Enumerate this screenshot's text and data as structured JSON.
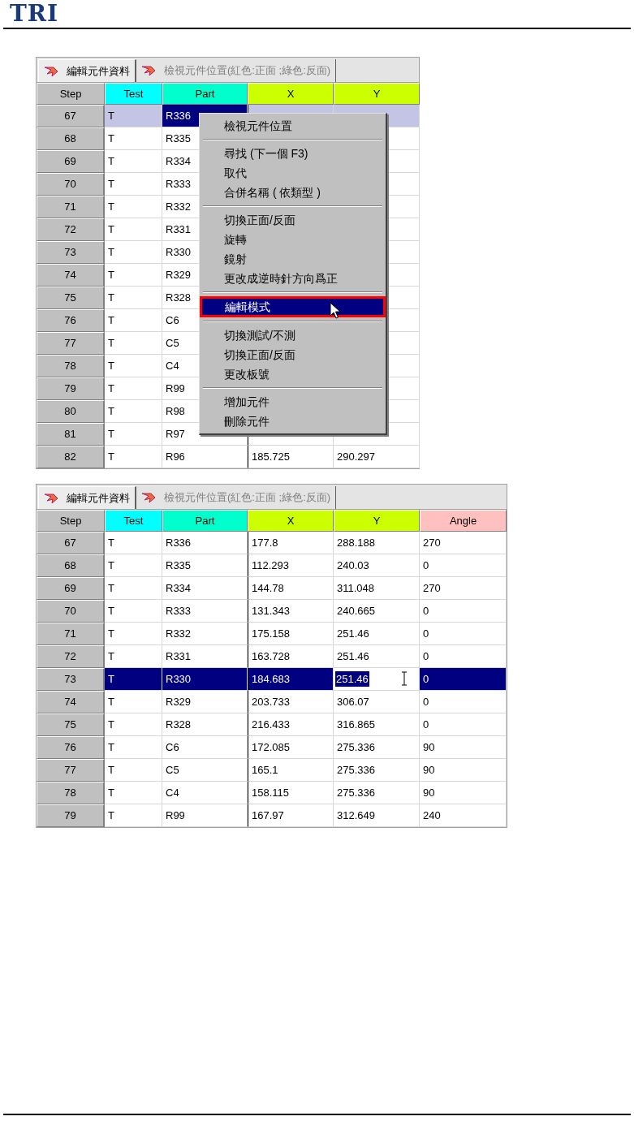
{
  "logo": "TRI",
  "grids": [
    {
      "tabs": [
        {
          "label": "編輯元件資料",
          "selected": true
        },
        {
          "label": "檢視元件位置(紅色:正面 ;綠色:反面)",
          "selected": false
        }
      ],
      "columns": [
        {
          "label": "Step",
          "color": "#c0c0c0"
        },
        {
          "label": "Test",
          "color": "#00ffff"
        },
        {
          "label": "Part",
          "color": "#00ffcc"
        },
        {
          "label": "X",
          "color": "#ccff00"
        },
        {
          "label": "Y",
          "color": "#ccff00"
        }
      ],
      "rows": [
        {
          "step": "67",
          "selected": true,
          "cells": [
            {
              "text": "T",
              "kind": "normal"
            },
            {
              "text": "R336",
              "kind": "focused"
            }
          ]
        },
        {
          "step": "68",
          "selected": false,
          "cells": [
            {
              "text": "T",
              "kind": "normal"
            },
            {
              "text": "R335",
              "kind": "normal"
            }
          ]
        },
        {
          "step": "69",
          "selected": false,
          "cells": [
            {
              "text": "T",
              "kind": "normal"
            },
            {
              "text": "R334",
              "kind": "normal"
            }
          ]
        },
        {
          "step": "70",
          "selected": false,
          "cells": [
            {
              "text": "T",
              "kind": "normal"
            },
            {
              "text": "R333",
              "kind": "normal"
            }
          ]
        },
        {
          "step": "71",
          "selected": false,
          "cells": [
            {
              "text": "T",
              "kind": "normal"
            },
            {
              "text": "R332",
              "kind": "normal"
            }
          ]
        },
        {
          "step": "72",
          "selected": false,
          "cells": [
            {
              "text": "T",
              "kind": "normal"
            },
            {
              "text": "R331",
              "kind": "normal"
            }
          ]
        },
        {
          "step": "73",
          "selected": false,
          "cells": [
            {
              "text": "T",
              "kind": "normal"
            },
            {
              "text": "R330",
              "kind": "normal"
            }
          ]
        },
        {
          "step": "74",
          "selected": false,
          "cells": [
            {
              "text": "T",
              "kind": "normal"
            },
            {
              "text": "R329",
              "kind": "normal"
            }
          ]
        },
        {
          "step": "75",
          "selected": false,
          "cells": [
            {
              "text": "T",
              "kind": "normal"
            },
            {
              "text": "R328",
              "kind": "normal"
            }
          ]
        },
        {
          "step": "76",
          "selected": false,
          "cells": [
            {
              "text": "T",
              "kind": "normal"
            },
            {
              "text": "C6",
              "kind": "normal"
            }
          ]
        },
        {
          "step": "77",
          "selected": false,
          "cells": [
            {
              "text": "T",
              "kind": "normal"
            },
            {
              "text": "C5",
              "kind": "normal"
            }
          ]
        },
        {
          "step": "78",
          "selected": false,
          "cells": [
            {
              "text": "T",
              "kind": "normal"
            },
            {
              "text": "C4",
              "kind": "normal"
            }
          ]
        },
        {
          "step": "79",
          "selected": false,
          "cells": [
            {
              "text": "T",
              "kind": "normal"
            },
            {
              "text": "R99",
              "kind": "normal"
            }
          ]
        },
        {
          "step": "80",
          "selected": false,
          "cells": [
            {
              "text": "T",
              "kind": "normal"
            },
            {
              "text": "R98",
              "kind": "normal"
            }
          ]
        },
        {
          "step": "81",
          "selected": false,
          "cells": [
            {
              "text": "T",
              "kind": "normal"
            },
            {
              "text": "R97",
              "kind": "normal"
            }
          ]
        },
        {
          "step": "82",
          "selected": false,
          "cells": [
            {
              "text": "T",
              "kind": "normal"
            },
            {
              "text": "R96",
              "kind": "normal"
            },
            {
              "text": "185.725",
              "kind": "normal"
            },
            {
              "text": "290.297",
              "kind": "normal"
            }
          ]
        }
      ],
      "context_menu": {
        "groups": [
          [
            {
              "label": "檢視元件位置",
              "highlighted": false
            }
          ],
          [
            {
              "label": "尋找 (下一個 F3)",
              "highlighted": false
            },
            {
              "label": "取代",
              "highlighted": false
            },
            {
              "label": "合併名稱 ( 依類型 )",
              "highlighted": false
            }
          ],
          [
            {
              "label": "切換正面/反面",
              "highlighted": false
            },
            {
              "label": "旋轉",
              "highlighted": false
            },
            {
              "label": "鏡射",
              "highlighted": false
            },
            {
              "label": "更改成逆時針方向爲正",
              "highlighted": false
            }
          ],
          [
            {
              "label": "編輯模式",
              "highlighted": true
            }
          ],
          [
            {
              "label": "切換測試/不測",
              "highlighted": false
            },
            {
              "label": "切換正面/反面",
              "highlighted": false
            },
            {
              "label": "更改板號",
              "highlighted": false
            }
          ],
          [
            {
              "label": "增加元件",
              "highlighted": false
            },
            {
              "label": "刪除元件",
              "highlighted": false
            }
          ]
        ]
      }
    },
    {
      "tabs": [
        {
          "label": "編輯元件資料",
          "selected": true
        },
        {
          "label": "檢視元件位置(紅色:正面 ;綠色:反面)",
          "selected": false
        }
      ],
      "columns": [
        {
          "label": "Step",
          "color": "#c0c0c0"
        },
        {
          "label": "Test",
          "color": "#00ffff"
        },
        {
          "label": "Part",
          "color": "#00ffcc"
        },
        {
          "label": "X",
          "color": "#ccff00"
        },
        {
          "label": "Y",
          "color": "#ccff00"
        },
        {
          "label": "Angle",
          "color": "#ffc0c0"
        }
      ],
      "rows": [
        {
          "step": "67",
          "selected": false,
          "cells": [
            {
              "text": "T",
              "kind": "normal"
            },
            {
              "text": "R336",
              "kind": "normal"
            },
            {
              "text": "177.8",
              "kind": "normal"
            },
            {
              "text": "288.188",
              "kind": "normal"
            },
            {
              "text": "270",
              "kind": "normal"
            }
          ]
        },
        {
          "step": "68",
          "selected": false,
          "cells": [
            {
              "text": "T",
              "kind": "normal"
            },
            {
              "text": "R335",
              "kind": "normal"
            },
            {
              "text": "112.293",
              "kind": "normal"
            },
            {
              "text": "240.03",
              "kind": "normal"
            },
            {
              "text": "0",
              "kind": "normal"
            }
          ]
        },
        {
          "step": "69",
          "selected": false,
          "cells": [
            {
              "text": "T",
              "kind": "normal"
            },
            {
              "text": "R334",
              "kind": "normal"
            },
            {
              "text": "144.78",
              "kind": "normal"
            },
            {
              "text": "311.048",
              "kind": "normal"
            },
            {
              "text": "270",
              "kind": "normal"
            }
          ]
        },
        {
          "step": "70",
          "selected": false,
          "cells": [
            {
              "text": "T",
              "kind": "normal"
            },
            {
              "text": "R333",
              "kind": "normal"
            },
            {
              "text": "131.343",
              "kind": "normal"
            },
            {
              "text": "240.665",
              "kind": "normal"
            },
            {
              "text": "0",
              "kind": "normal"
            }
          ]
        },
        {
          "step": "71",
          "selected": false,
          "cells": [
            {
              "text": "T",
              "kind": "normal"
            },
            {
              "text": "R332",
              "kind": "normal"
            },
            {
              "text": "175.158",
              "kind": "normal"
            },
            {
              "text": "251.46",
              "kind": "normal"
            },
            {
              "text": "0",
              "kind": "normal"
            }
          ]
        },
        {
          "step": "72",
          "selected": false,
          "cells": [
            {
              "text": "T",
              "kind": "normal"
            },
            {
              "text": "R331",
              "kind": "normal"
            },
            {
              "text": "163.728",
              "kind": "normal"
            },
            {
              "text": "251.46",
              "kind": "normal"
            },
            {
              "text": "0",
              "kind": "normal"
            }
          ]
        },
        {
          "step": "73",
          "selected": true,
          "cells": [
            {
              "text": "T",
              "kind": "normal"
            },
            {
              "text": "R330",
              "kind": "normal"
            },
            {
              "text": "184.683",
              "kind": "normal"
            },
            {
              "text": "251.46",
              "kind": "editing"
            },
            {
              "text": "0",
              "kind": "normal"
            }
          ]
        },
        {
          "step": "74",
          "selected": false,
          "cells": [
            {
              "text": "T",
              "kind": "normal"
            },
            {
              "text": "R329",
              "kind": "normal"
            },
            {
              "text": "203.733",
              "kind": "normal"
            },
            {
              "text": "306.07",
              "kind": "normal"
            },
            {
              "text": "0",
              "kind": "normal"
            }
          ]
        },
        {
          "step": "75",
          "selected": false,
          "cells": [
            {
              "text": "T",
              "kind": "normal"
            },
            {
              "text": "R328",
              "kind": "normal"
            },
            {
              "text": "216.433",
              "kind": "normal"
            },
            {
              "text": "316.865",
              "kind": "normal"
            },
            {
              "text": "0",
              "kind": "normal"
            }
          ]
        },
        {
          "step": "76",
          "selected": false,
          "cells": [
            {
              "text": "T",
              "kind": "normal"
            },
            {
              "text": "C6",
              "kind": "normal"
            },
            {
              "text": "172.085",
              "kind": "normal"
            },
            {
              "text": "275.336",
              "kind": "normal"
            },
            {
              "text": "90",
              "kind": "normal"
            }
          ]
        },
        {
          "step": "77",
          "selected": false,
          "cells": [
            {
              "text": "T",
              "kind": "normal"
            },
            {
              "text": "C5",
              "kind": "normal"
            },
            {
              "text": "165.1",
              "kind": "normal"
            },
            {
              "text": "275.336",
              "kind": "normal"
            },
            {
              "text": "90",
              "kind": "normal"
            }
          ]
        },
        {
          "step": "78",
          "selected": false,
          "cells": [
            {
              "text": "T",
              "kind": "normal"
            },
            {
              "text": "C4",
              "kind": "normal"
            },
            {
              "text": "158.115",
              "kind": "normal"
            },
            {
              "text": "275.336",
              "kind": "normal"
            },
            {
              "text": "90",
              "kind": "normal"
            }
          ]
        },
        {
          "step": "79",
          "selected": false,
          "cells": [
            {
              "text": "T",
              "kind": "normal"
            },
            {
              "text": "R99",
              "kind": "normal"
            },
            {
              "text": "167.97",
              "kind": "normal"
            },
            {
              "text": "312.649",
              "kind": "normal"
            },
            {
              "text": "240",
              "kind": "normal"
            }
          ]
        }
      ]
    }
  ]
}
